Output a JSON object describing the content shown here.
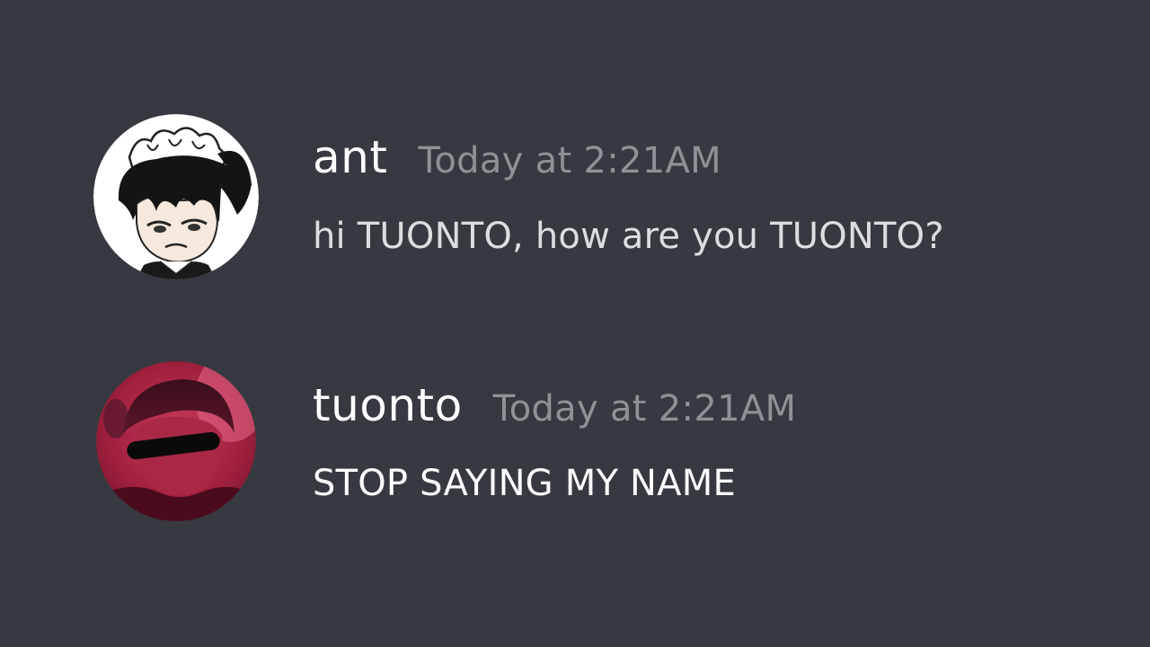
{
  "theme": {
    "background": "#36393f",
    "username_color": "#ffffff",
    "timestamp_color": "#8e9297",
    "message_color": "#dcddde"
  },
  "messages": [
    {
      "username": "ant",
      "timestamp": "Today at 2:21AM",
      "content": "hi TUONTO, how are you TUONTO?",
      "avatar_icon": "maid-anime-character-avatar"
    },
    {
      "username": "tuonto",
      "timestamp": "Today at 2:21AM",
      "content": "STOP SAYING MY NAME",
      "avatar_icon": "red-tinted-photo-avatar"
    }
  ]
}
